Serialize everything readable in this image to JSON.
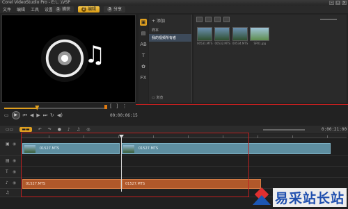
{
  "window": {
    "title": "Corel VideoStudio Pro - E:\\...\\VSP"
  },
  "menu": [
    "文件",
    "编辑",
    "工具",
    "设置"
  ],
  "steps": [
    {
      "num": "1",
      "label": "捕获"
    },
    {
      "num": "2",
      "label": "编辑"
    },
    {
      "num": "3",
      "label": "分享"
    }
  ],
  "player": {
    "timecode": "00:00:06:15",
    "progress": 0.32
  },
  "library": {
    "add_label": "添加",
    "folders": [
      "样本",
      "我的视频所有者"
    ],
    "browse_label": "浏览",
    "thumbs": [
      "00531.MTS",
      "00532.MTS",
      "00534.MTS",
      "SP01.jpg"
    ]
  },
  "timeline": {
    "time": "0:00:21:00",
    "video_clips": [
      {
        "label": "01527.MTS"
      },
      {
        "label": "01527.MTS"
      }
    ],
    "audio_clips": [
      {
        "label": "01527.MTS"
      },
      {
        "label": "01527.MTS"
      }
    ]
  },
  "watermark": {
    "text": "易采站长站"
  },
  "colors": {
    "accent": "#e0a020",
    "video_clip": "#5e8ea0",
    "audio_clip": "#b0582a",
    "highlight": "#c02020"
  }
}
